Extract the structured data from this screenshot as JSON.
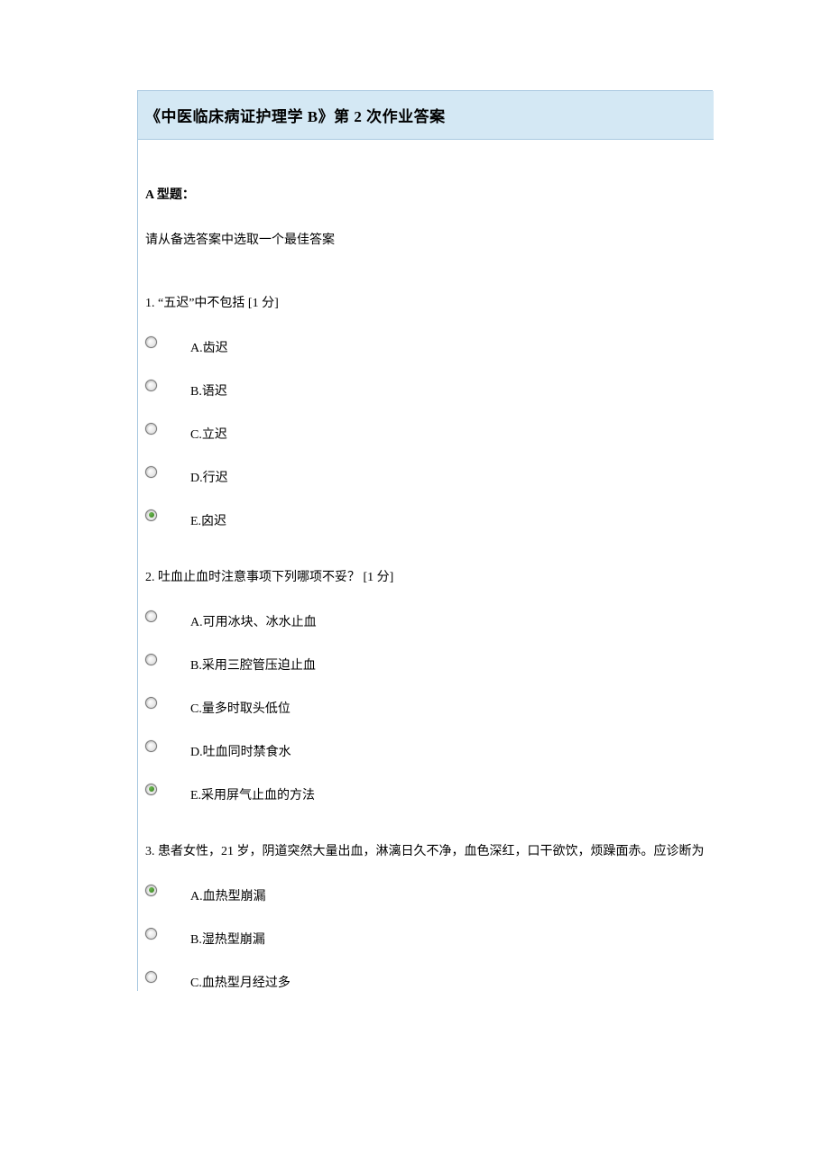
{
  "title": "《中医临床病证护理学 B》第 2 次作业答案",
  "section": {
    "heading": "A 型题：",
    "sub": "请从备选答案中选取一个最佳答案"
  },
  "questions": [
    {
      "text": "1. “五迟”中不包括 [1 分]",
      "options": [
        {
          "label": "A.齿迟",
          "selected": false
        },
        {
          "label": "B.语迟",
          "selected": false
        },
        {
          "label": "C.立迟",
          "selected": false
        },
        {
          "label": "D.行迟",
          "selected": false
        },
        {
          "label": "E.囟迟",
          "selected": true
        }
      ]
    },
    {
      "text": "2. 吐血止血时注意事项下列哪项不妥？ [1 分]",
      "options": [
        {
          "label": "A.可用冰块、冰水止血",
          "selected": false
        },
        {
          "label": "B.采用三腔管压迫止血",
          "selected": false
        },
        {
          "label": "C.量多时取头低位",
          "selected": false
        },
        {
          "label": "D.吐血同时禁食水",
          "selected": false
        },
        {
          "label": "E.采用屏气止血的方法",
          "selected": true
        }
      ]
    },
    {
      "text": "3. 患者女性，21 岁，阴道突然大量出血，淋漓日久不净，血色深红，口干欲饮，烦躁面赤。应诊断为",
      "options": [
        {
          "label": "A.血热型崩漏",
          "selected": true
        },
        {
          "label": "B.湿热型崩漏",
          "selected": false
        },
        {
          "label": "C.血热型月经过多",
          "selected": false
        }
      ]
    }
  ]
}
